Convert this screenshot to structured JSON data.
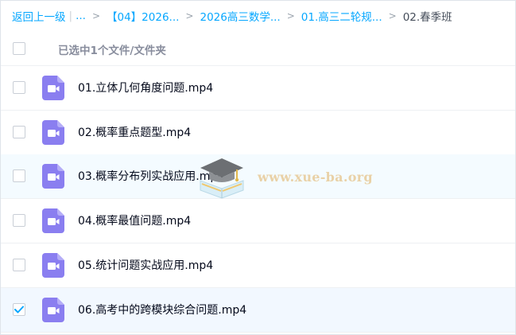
{
  "breadcrumb": {
    "back_label": "返回上一级",
    "pipe": "|",
    "ellipsis": "...",
    "separator": ">",
    "items": [
      "【04】2026...",
      "2026高三数学...",
      "01.高三二轮规..."
    ],
    "current": "02.春季班"
  },
  "header": {
    "selection_status": "已选中1个文件/文件夹"
  },
  "files": [
    {
      "name": "01.立体几何角度问题.mp4",
      "checked": false,
      "icon": "video-file-icon"
    },
    {
      "name": "02.概率重点题型.mp4",
      "checked": false,
      "icon": "video-file-icon"
    },
    {
      "name": "03.概率分布列实战应用.mp4",
      "checked": false,
      "icon": "video-file-icon"
    },
    {
      "name": "04.概率最值问题.mp4",
      "checked": false,
      "icon": "video-file-icon"
    },
    {
      "name": "05.统计问题实战应用.mp4",
      "checked": false,
      "icon": "video-file-icon"
    },
    {
      "name": "06.高考中的跨模块综合问题.mp4",
      "checked": true,
      "icon": "video-file-icon"
    }
  ],
  "watermark": {
    "text": "www.xue-ba.org"
  },
  "colors": {
    "link": "#06a7ff",
    "video_icon": "#8a7ef0",
    "checkbox_checked": "#06a7ff",
    "row_hover": "#f4fbff",
    "row_selected": "#f2f8ff"
  }
}
